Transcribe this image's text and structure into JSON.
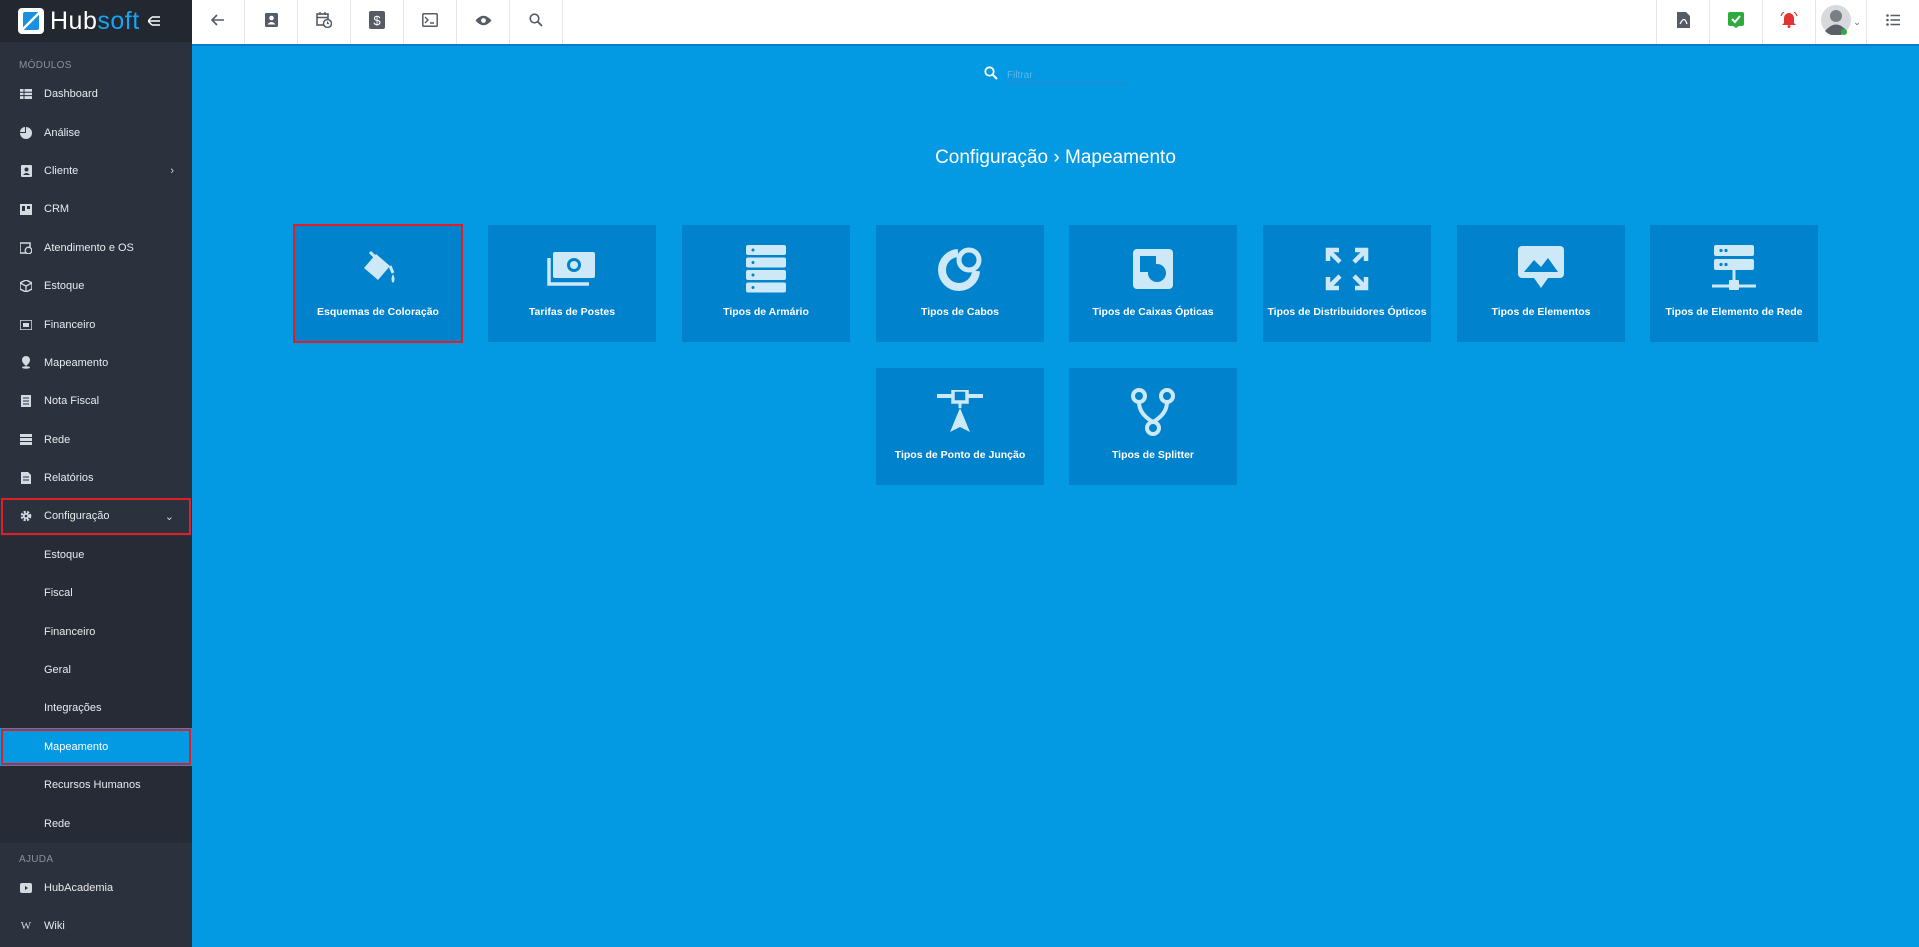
{
  "logo": {
    "hub": "Hub",
    "soft": "soft"
  },
  "sidebar": {
    "modules_label": "MÓDULOS",
    "items": [
      {
        "label": "Dashboard",
        "icon": "table-icon"
      },
      {
        "label": "Análise",
        "icon": "pie-chart-icon"
      },
      {
        "label": "Cliente",
        "icon": "contact-card-icon",
        "expandable": true
      },
      {
        "label": "CRM",
        "icon": "board-icon"
      },
      {
        "label": "Atendimento e OS",
        "icon": "calendar-clock-icon"
      },
      {
        "label": "Estoque",
        "icon": "box-icon"
      },
      {
        "label": "Financeiro",
        "icon": "money-icon"
      },
      {
        "label": "Mapeamento",
        "icon": "map-pin-icon"
      },
      {
        "label": "Nota Fiscal",
        "icon": "document-icon"
      },
      {
        "label": "Rede",
        "icon": "server-icon"
      },
      {
        "label": "Relatórios",
        "icon": "report-icon"
      },
      {
        "label": "Configuração",
        "icon": "gear-icon",
        "expanded": true
      }
    ],
    "config_submenu": [
      {
        "label": "Estoque"
      },
      {
        "label": "Fiscal"
      },
      {
        "label": "Financeiro"
      },
      {
        "label": "Geral"
      },
      {
        "label": "Integrações"
      },
      {
        "label": "Mapeamento",
        "active": true
      },
      {
        "label": "Recursos Humanos"
      },
      {
        "label": "Rede"
      }
    ],
    "help_label": "AJUDA",
    "help_items": [
      {
        "label": "HubAcademia",
        "icon": "video-icon"
      },
      {
        "label": "Wiki",
        "icon": "wikipedia-icon"
      }
    ]
  },
  "topbar": {
    "left_icons": [
      "back-arrow-icon",
      "contact-icon",
      "calendar-clock-icon",
      "dollar-icon",
      "terminal-icon",
      "eye-icon",
      "search-icon"
    ],
    "right_icons": [
      "pdf-icon",
      "check-badge-icon",
      "alarm-bell-icon",
      "user-avatar-icon",
      "list-menu-icon"
    ]
  },
  "filter": {
    "placeholder": "Filtrar"
  },
  "page": {
    "breadcrumb_parent": "Configuração",
    "separator": "›",
    "breadcrumb_current": "Mapeamento"
  },
  "tiles": [
    {
      "label": "Esquemas de Coloração",
      "icon": "paint-bucket-icon",
      "selected": true
    },
    {
      "label": "Tarifas de Postes",
      "icon": "money-bills-icon"
    },
    {
      "label": "Tipos de Armário",
      "icon": "server-rack-icon"
    },
    {
      "label": "Tipos de Cabos",
      "icon": "cable-ring-icon"
    },
    {
      "label": "Tipos de Caixas Ópticas",
      "icon": "shapes-icon"
    },
    {
      "label": "Tipos de Distribuidores Ópticos",
      "icon": "expand-arrows-icon"
    },
    {
      "label": "Tipos de Elementos",
      "icon": "image-pin-icon"
    },
    {
      "label": "Tipos de Elemento de Rede",
      "icon": "network-server-icon"
    },
    {
      "label": "Tipos de Ponto de Junção",
      "icon": "junction-point-icon"
    },
    {
      "label": "Tipos de Splitter",
      "icon": "splitter-icon"
    }
  ],
  "colors": {
    "sidebar_bg": "#2c313e",
    "main_bg": "#0399e3",
    "tile_bg": "#0182cc",
    "highlight": "#e11d26"
  }
}
